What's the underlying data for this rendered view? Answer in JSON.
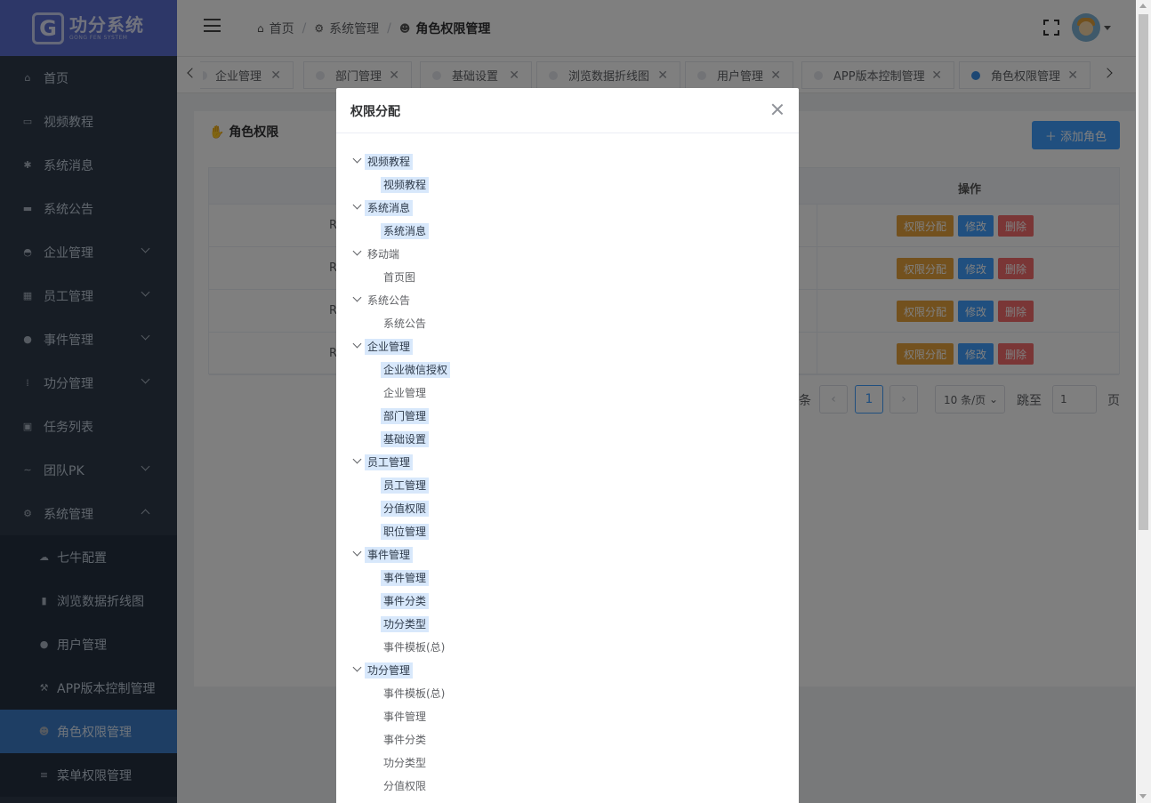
{
  "logo": {
    "mark": "G",
    "title": "功分系统",
    "subtitle": "GONG FEN SYSTEM"
  },
  "sidebar": {
    "items": [
      {
        "label": "首页",
        "icon": "home-icon",
        "glyph": "⌂"
      },
      {
        "label": "视频教程",
        "icon": "book-icon",
        "glyph": "▭"
      },
      {
        "label": "系统消息",
        "icon": "asterisk-icon",
        "glyph": "✱"
      },
      {
        "label": "系统公告",
        "icon": "card-icon",
        "glyph": "▬"
      },
      {
        "label": "企业管理",
        "icon": "building-icon",
        "glyph": "◓"
      },
      {
        "label": "员工管理",
        "icon": "grid-icon",
        "glyph": "▦"
      },
      {
        "label": "事件管理",
        "icon": "dot-icon",
        "glyph": "●"
      },
      {
        "label": "功分管理",
        "icon": "dots-grid-icon",
        "glyph": "⁞"
      },
      {
        "label": "任务列表",
        "icon": "checklist-icon",
        "glyph": "▣"
      },
      {
        "label": "团队PK",
        "icon": "wave-icon",
        "glyph": "∼"
      },
      {
        "label": "系统管理",
        "icon": "gear-icon",
        "glyph": "⚙"
      }
    ],
    "sub_items": [
      {
        "label": "七牛配置",
        "icon": "cloud-icon",
        "glyph": "☁"
      },
      {
        "label": "浏览数据折线图",
        "icon": "file-icon",
        "glyph": "▮"
      },
      {
        "label": "用户管理",
        "icon": "user-icon",
        "glyph": "●"
      },
      {
        "label": "APP版本控制管理",
        "icon": "wrench-icon",
        "glyph": "⚒"
      },
      {
        "label": "角色权限管理",
        "icon": "users-icon",
        "glyph": "☻"
      },
      {
        "label": "菜单权限管理",
        "icon": "list-icon",
        "glyph": "≡"
      }
    ]
  },
  "breadcrumb": [
    {
      "label": "首页",
      "glyph": "⌂"
    },
    {
      "label": "系统管理",
      "glyph": "⚙"
    },
    {
      "label": "角色权限管理",
      "glyph": "☻"
    }
  ],
  "tabs": [
    {
      "label": "企业管理"
    },
    {
      "label": "部门管理"
    },
    {
      "label": "基础设置"
    },
    {
      "label": "浏览数据折线图"
    },
    {
      "label": "用户管理"
    },
    {
      "label": "APP版本控制管理"
    },
    {
      "label": "角色权限管理"
    }
  ],
  "page": {
    "title": "角色权限",
    "add_button": "＋ 添加角色",
    "column_op": "操作",
    "rows": [
      {
        "name": "R"
      },
      {
        "name": "ROL"
      },
      {
        "name": "RO"
      },
      {
        "name": "R"
      }
    ],
    "row_buttons": {
      "perm": "权限分配",
      "edit": "修改",
      "delete": "删除"
    },
    "pagination": {
      "total_suffix": "条",
      "current": "1",
      "page_size": "10 条/页",
      "jump_label": "跳至",
      "jump_value": "1",
      "page_suffix": "页"
    }
  },
  "dialog": {
    "title": "权限分配",
    "tree": [
      {
        "label": "视频教程",
        "level": 0,
        "selected": true
      },
      {
        "label": "视频教程",
        "level": 1,
        "selected": true
      },
      {
        "label": "系统消息",
        "level": 0,
        "selected": true
      },
      {
        "label": "系统消息",
        "level": 1,
        "selected": true
      },
      {
        "label": "移动端",
        "level": 0,
        "selected": false
      },
      {
        "label": "首页图",
        "level": 1,
        "selected": false
      },
      {
        "label": "系统公告",
        "level": 0,
        "selected": false
      },
      {
        "label": "系统公告",
        "level": 1,
        "selected": false
      },
      {
        "label": "企业管理",
        "level": 0,
        "selected": true
      },
      {
        "label": "企业微信授权",
        "level": 1,
        "selected": true
      },
      {
        "label": "企业管理",
        "level": 1,
        "selected": false
      },
      {
        "label": "部门管理",
        "level": 1,
        "selected": true
      },
      {
        "label": "基础设置",
        "level": 1,
        "selected": true
      },
      {
        "label": "员工管理",
        "level": 0,
        "selected": true
      },
      {
        "label": "员工管理",
        "level": 1,
        "selected": true
      },
      {
        "label": "分值权限",
        "level": 1,
        "selected": true
      },
      {
        "label": "职位管理",
        "level": 1,
        "selected": true
      },
      {
        "label": "事件管理",
        "level": 0,
        "selected": true
      },
      {
        "label": "事件管理",
        "level": 1,
        "selected": true
      },
      {
        "label": "事件分类",
        "level": 1,
        "selected": true
      },
      {
        "label": "功分类型",
        "level": 1,
        "selected": true
      },
      {
        "label": "事件模板(总)",
        "level": 1,
        "selected": false
      },
      {
        "label": "功分管理",
        "level": 0,
        "selected": true
      },
      {
        "label": "事件模板(总)",
        "level": 1,
        "selected": false
      },
      {
        "label": "事件管理",
        "level": 1,
        "selected": false
      },
      {
        "label": "事件分类",
        "level": 1,
        "selected": false
      },
      {
        "label": "功分类型",
        "level": 1,
        "selected": false
      },
      {
        "label": "分值权限",
        "level": 1,
        "selected": false
      }
    ]
  },
  "colors": {
    "sidebar_bg": "#2f3b4b",
    "logo_bg": "#5b6fd0",
    "active_menu": "#3d7cc9",
    "primary": "#409eff",
    "warning": "#e6a23c",
    "danger": "#f56c6c",
    "tree_selected": "#d8e8fb"
  }
}
